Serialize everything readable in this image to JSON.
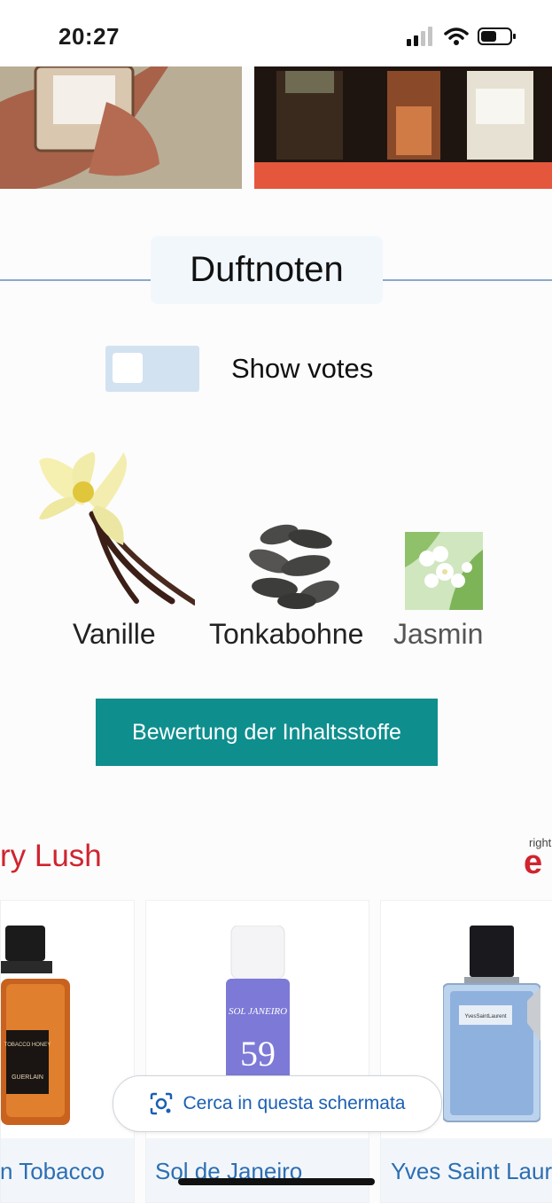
{
  "status_bar": {
    "time": "20:27"
  },
  "section": {
    "heading": "Duftnoten"
  },
  "votes_toggle": {
    "label": "Show votes",
    "checked": false
  },
  "notes": [
    {
      "name": "Vanille"
    },
    {
      "name": "Tonkabohne"
    },
    {
      "name": "Jasmin"
    }
  ],
  "rating_button": {
    "label": "Bewertung der Inhaltsstoffe"
  },
  "ad_banner": {
    "title": "ry Lush",
    "corner_small": "right",
    "corner_large": "e"
  },
  "products": [
    {
      "name": "n Tobacco",
      "bottle_text": "TOBACCO HONEY",
      "brand": "GUERLAIN"
    },
    {
      "name": "Sol de Janeiro",
      "bottle_text": "SOL JANEIRO",
      "number": "59"
    },
    {
      "name": "Yves Saint Laur",
      "bottle_text": "YvesSaintLaurent"
    }
  ],
  "lens_search": {
    "label": "Cerca in questa schermata"
  },
  "colors": {
    "accent": "#0f8e8e",
    "brand_red": "#d0242f",
    "link_blue": "#2c6fb4"
  }
}
